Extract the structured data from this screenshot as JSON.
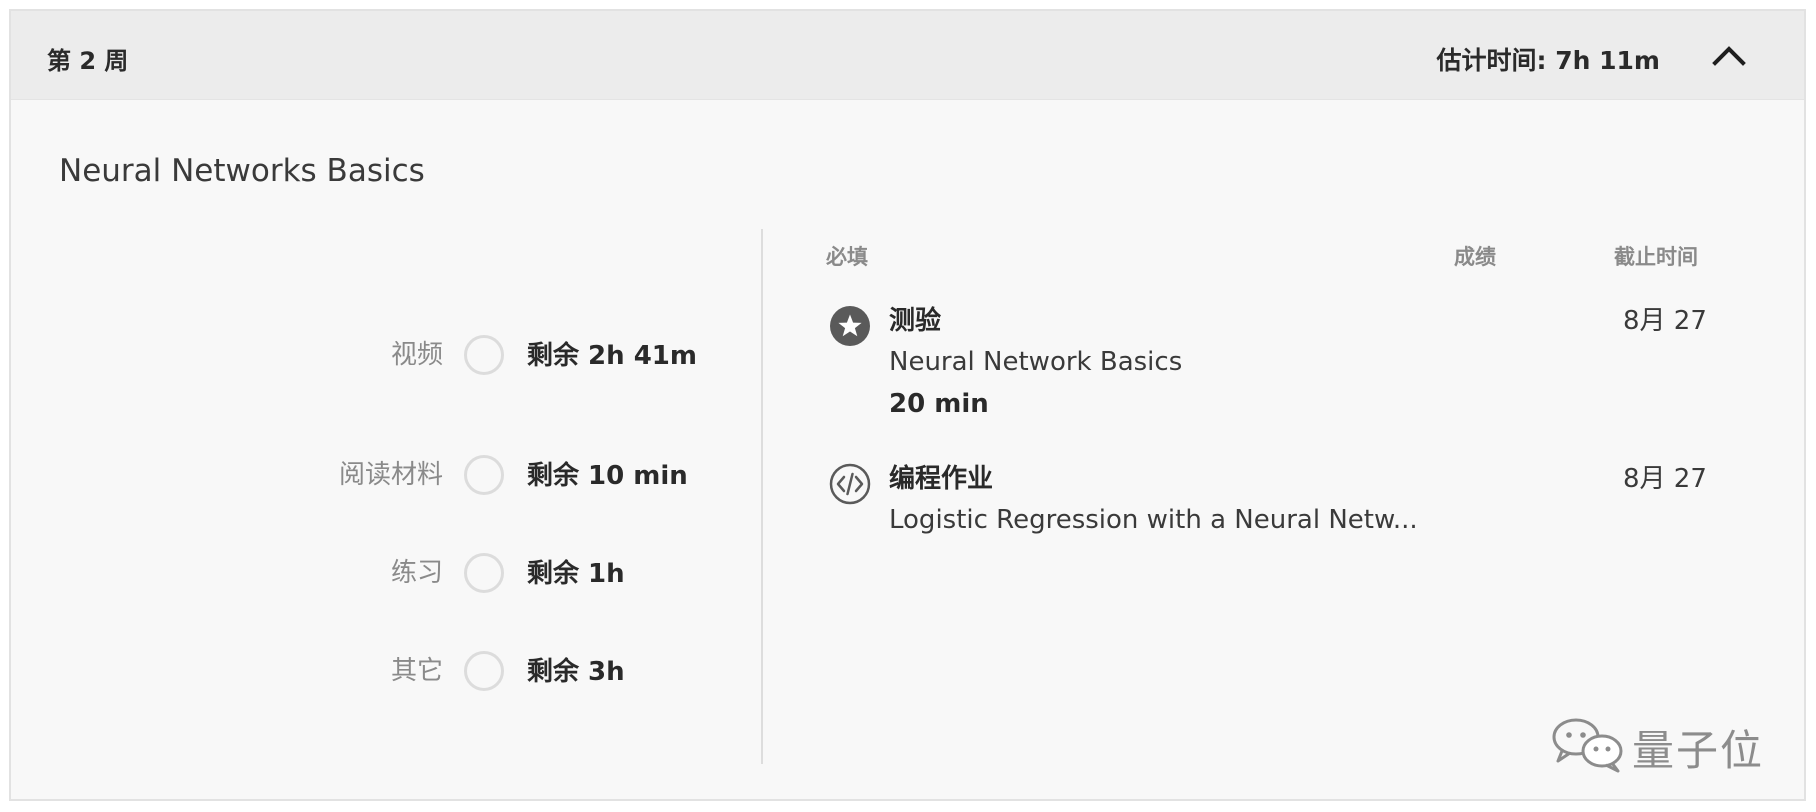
{
  "week": {
    "title": "第 2 周",
    "estimate": "估计时间: 7h 11m"
  },
  "module": {
    "title": "Neural Networks Basics"
  },
  "progress": [
    {
      "label": "视频",
      "remaining": "剩余 2h 41m"
    },
    {
      "label": "阅读材料",
      "remaining": "剩余 10 min"
    },
    {
      "label": "练习",
      "remaining": "剩余 1h"
    },
    {
      "label": "其它",
      "remaining": "剩余 3h"
    }
  ],
  "table": {
    "headers": {
      "required": "必填",
      "grade": "成绩",
      "due": "截止时间"
    },
    "items": [
      {
        "type": "测验",
        "name": "Neural Network Basics",
        "duration": "20 min",
        "due": "8月 27",
        "icon": "star-badge-icon"
      },
      {
        "type": "编程作业",
        "name": "Logistic Regression with a Neural Netw...",
        "due": "8月 27",
        "icon": "code-icon"
      }
    ]
  },
  "watermark": {
    "text": "量子位",
    "icon": "wechat-icon"
  },
  "colors": {
    "header_bg": "#ececec",
    "card_bg": "#f8f8f8",
    "icon_dark": "#5a5a5a",
    "muted_text": "#8a8a8a"
  }
}
